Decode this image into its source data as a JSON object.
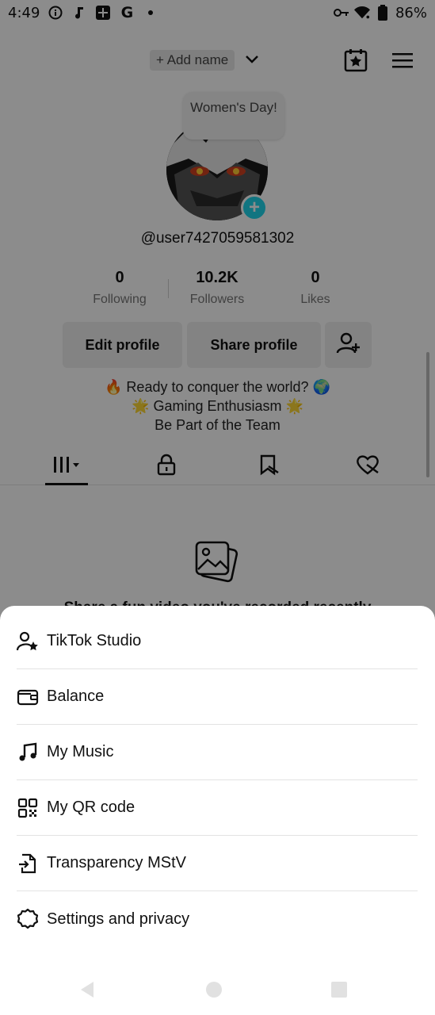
{
  "status_bar": {
    "time": "4:49",
    "battery": "86%",
    "left_icons": [
      "info-icon",
      "music-note-icon",
      "plus-box-icon",
      "google-icon",
      "dot-icon"
    ],
    "right_icons": [
      "vpn-key-icon",
      "wifi-icon",
      "battery-icon"
    ]
  },
  "header": {
    "add_name": "+ Add name",
    "bubble_text": "Women's Day!"
  },
  "profile": {
    "username": "@user7427059581302",
    "stats": [
      {
        "value": "0",
        "label": "Following"
      },
      {
        "value": "10.2K",
        "label": "Followers"
      },
      {
        "value": "0",
        "label": "Likes"
      }
    ],
    "buttons": {
      "edit": "Edit profile",
      "share": "Share profile"
    },
    "bio": [
      "🔥 Ready to conquer the world? 🌍",
      "🌟 Gaming Enthusiasm 🌟",
      "Be Part of the Team"
    ]
  },
  "tabs": [
    "videos-tab",
    "private-tab",
    "reposts-tab",
    "liked-tab"
  ],
  "empty_state": {
    "text": "Share a fun video you've recorded recently"
  },
  "sheet_menu": {
    "items": [
      {
        "label": "TikTok Studio",
        "icon": "person-star-icon"
      },
      {
        "label": "Balance",
        "icon": "wallet-icon"
      },
      {
        "label": "My Music",
        "icon": "music-note-icon"
      },
      {
        "label": "My QR code",
        "icon": "qr-code-icon"
      },
      {
        "label": "Transparency MStV",
        "icon": "document-export-icon"
      },
      {
        "label": "Settings and privacy",
        "icon": "gear-icon"
      }
    ]
  },
  "colors": {
    "accent": "#20d5ec",
    "overlay": "rgba(0,0,0,0.45)"
  }
}
